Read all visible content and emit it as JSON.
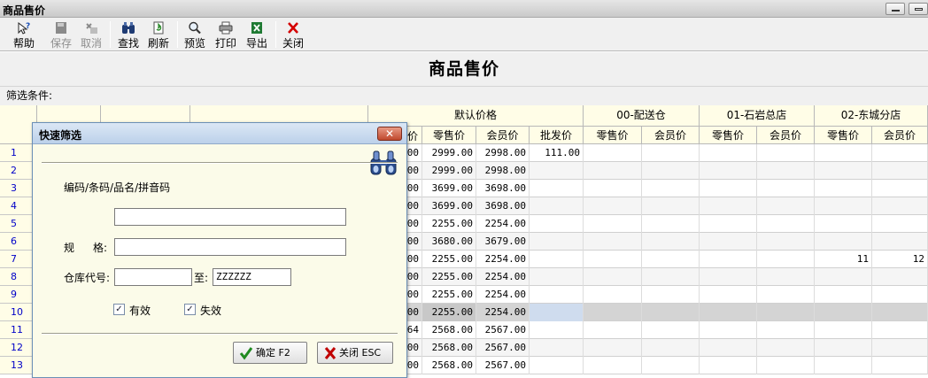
{
  "window": {
    "title": "商品售价"
  },
  "toolbar": {
    "help": "帮助",
    "save": "保存",
    "cancel": "取消",
    "find": "查找",
    "refresh": "刷新",
    "preview": "预览",
    "print": "打印",
    "export": "导出",
    "close": "关闭"
  },
  "page": {
    "title": "商品售价",
    "filter_label": "筛选条件:"
  },
  "grid": {
    "groups": [
      "默认价格",
      "00-配送仓",
      "01-石岩总店",
      "02-东城分店"
    ],
    "subheaders": [
      "零售价",
      "会员价",
      "批发价",
      "零售价",
      "会员价",
      "零售价",
      "会员价",
      "零售价",
      "会员价"
    ],
    "partial_header": "价",
    "rows": [
      {
        "num": "1",
        "clip": "00",
        "retail": "2999.00",
        "member": "2998.00",
        "wholesale": "111.00",
        "s02_retail": "",
        "s02_member": ""
      },
      {
        "num": "2",
        "clip": "00",
        "retail": "2999.00",
        "member": "2998.00",
        "wholesale": "",
        "s02_retail": "",
        "s02_member": ""
      },
      {
        "num": "3",
        "clip": "00",
        "retail": "3699.00",
        "member": "3698.00",
        "wholesale": "",
        "s02_retail": "",
        "s02_member": ""
      },
      {
        "num": "4",
        "clip": "00",
        "retail": "3699.00",
        "member": "3698.00",
        "wholesale": "",
        "s02_retail": "",
        "s02_member": ""
      },
      {
        "num": "5",
        "clip": "00",
        "retail": "2255.00",
        "member": "2254.00",
        "wholesale": "",
        "s02_retail": "",
        "s02_member": ""
      },
      {
        "num": "6",
        "clip": "00",
        "retail": "3680.00",
        "member": "3679.00",
        "wholesale": "",
        "s02_retail": "",
        "s02_member": ""
      },
      {
        "num": "7",
        "clip": "00",
        "retail": "2255.00",
        "member": "2254.00",
        "wholesale": "",
        "s02_retail": "11",
        "s02_member": "12"
      },
      {
        "num": "8",
        "clip": "00",
        "retail": "2255.00",
        "member": "2254.00",
        "wholesale": "",
        "s02_retail": "",
        "s02_member": ""
      },
      {
        "num": "9",
        "clip": "00",
        "retail": "2255.00",
        "member": "2254.00",
        "wholesale": "",
        "s02_retail": "",
        "s02_member": ""
      },
      {
        "num": "10",
        "clip": "00",
        "retail": "2255.00",
        "member": "2254.00",
        "wholesale": "",
        "s02_retail": "",
        "s02_member": ""
      },
      {
        "num": "11",
        "clip": "64",
        "retail": "2568.00",
        "member": "2567.00",
        "wholesale": "",
        "s02_retail": "",
        "s02_member": ""
      },
      {
        "num": "12",
        "clip": "00",
        "retail": "2568.00",
        "member": "2567.00",
        "wholesale": "",
        "s02_retail": "",
        "s02_member": ""
      },
      {
        "num": "13",
        "clip": "00",
        "retail": "2568.00",
        "member": "2567.00",
        "wholesale": "",
        "s02_retail": "",
        "s02_member": ""
      }
    ]
  },
  "dialog": {
    "title": "快速筛选",
    "close_glyph": "✕",
    "code_label": "编码/条码/品名/拼音码",
    "code_value": "",
    "spec_label_a": "规",
    "spec_label_b": "格:",
    "spec_value": "",
    "warehouse_label": "仓库代号:",
    "warehouse_from": "",
    "to_label": "至:",
    "warehouse_to": "ZZZZZZ",
    "valid_label": "有效",
    "invalid_label": "失效",
    "valid_checked": true,
    "invalid_checked": true,
    "ok_label": "确定 F2",
    "cancel_label": "关闭 ESC"
  },
  "icons": {
    "help": "help-icon",
    "save": "save-icon",
    "cancel": "cancel-icon",
    "find": "binoculars-icon",
    "refresh": "refresh-icon",
    "preview": "magnifier-icon",
    "print": "printer-icon",
    "export": "excel-icon",
    "close": "close-x-icon"
  },
  "colors": {
    "header_bg": "#fffde7",
    "dialog_bg": "#fbfbe9",
    "selected_row": "#d4d4d4",
    "close_red": "#d40000",
    "row_number": "#0000c8"
  }
}
